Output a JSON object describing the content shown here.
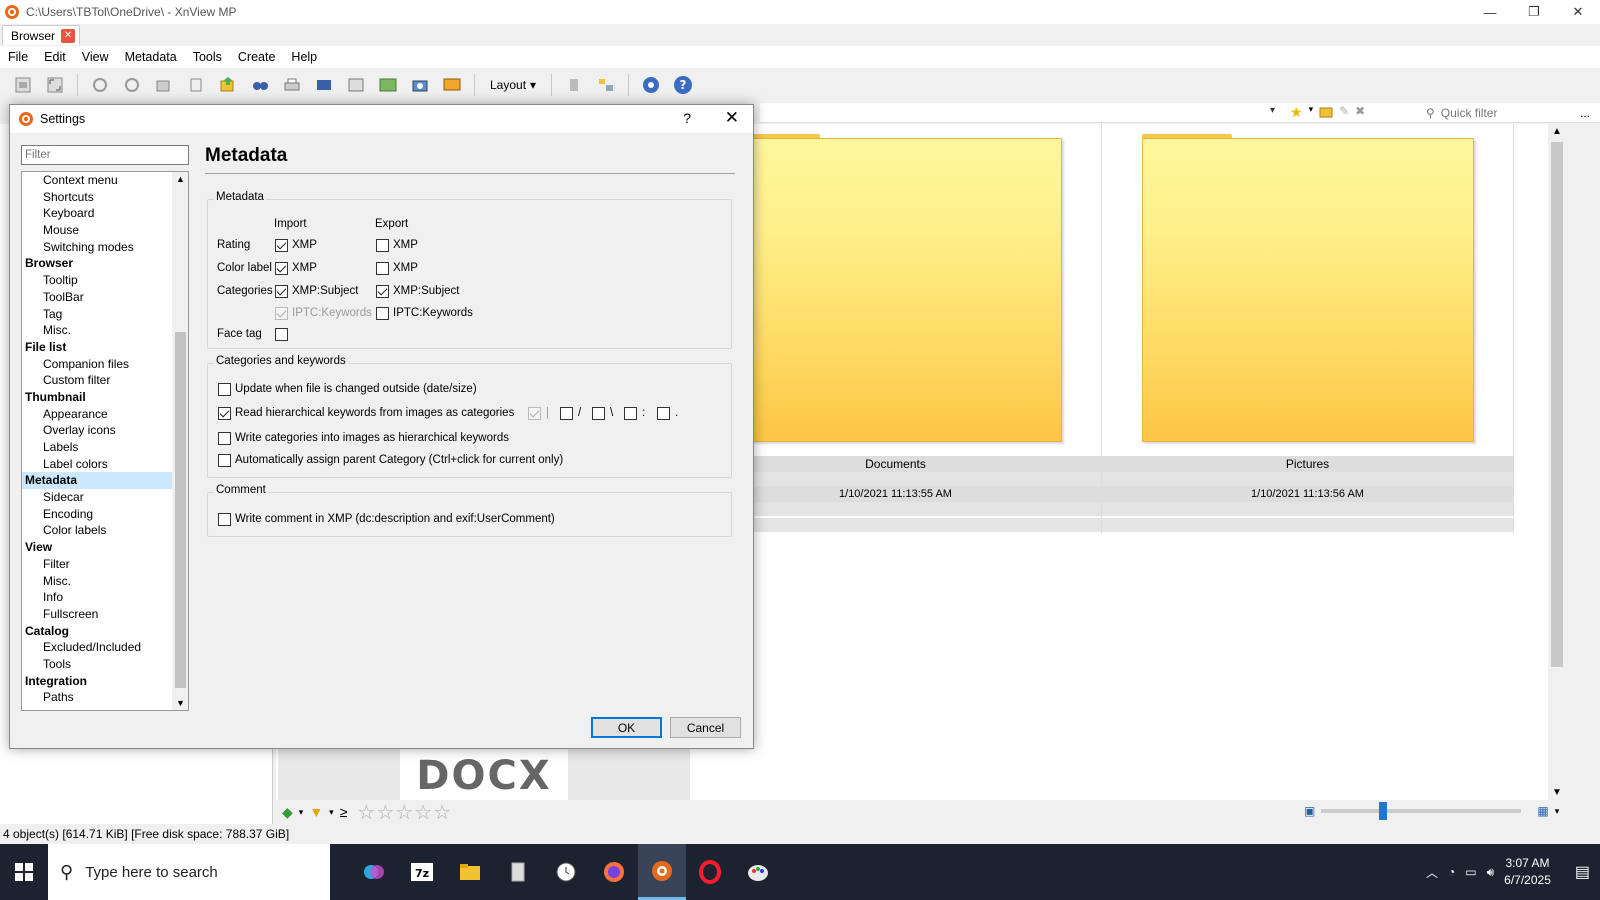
{
  "window": {
    "title": "C:\\Users\\TBTol\\OneDrive\\ - XnView MP",
    "controls": [
      "—",
      "❐",
      "✕"
    ]
  },
  "tab": {
    "label": "Browser",
    "close": "✕"
  },
  "menu": [
    "File",
    "Edit",
    "View",
    "Metadata",
    "Tools",
    "Create",
    "Help"
  ],
  "toolbar": {
    "layout_label": "Layout"
  },
  "quick_filter": {
    "placeholder": "Quick filter",
    "more": "..."
  },
  "browser": {
    "items": [
      {
        "name": "Documents",
        "date": "1/10/2021 11:13:55 AM"
      },
      {
        "name": "Pictures",
        "date": "1/10/2021 11:13:56 AM"
      }
    ],
    "docx_label": "DOCX"
  },
  "bottom": {
    "ge_symbol": "≥"
  },
  "status": {
    "text": "4 object(s) [614.71 KiB] [Free disk space: 788.37 GiB]"
  },
  "taskbar": {
    "search_placeholder": "Type here to search",
    "time": "3:07 AM",
    "date": "6/7/2025"
  },
  "dialog": {
    "title": "Settings",
    "help": "?",
    "close": "✕",
    "filter_placeholder": "Filter",
    "page_title": "Metadata",
    "nav": [
      {
        "label": "Context menu",
        "group": false
      },
      {
        "label": "Shortcuts",
        "group": false
      },
      {
        "label": "Keyboard",
        "group": false
      },
      {
        "label": "Mouse",
        "group": false
      },
      {
        "label": "Switching modes",
        "group": false
      },
      {
        "label": "Browser",
        "group": true
      },
      {
        "label": "Tooltip",
        "group": false
      },
      {
        "label": "ToolBar",
        "group": false
      },
      {
        "label": "Tag",
        "group": false
      },
      {
        "label": "Misc.",
        "group": false
      },
      {
        "label": "File list",
        "group": true
      },
      {
        "label": "Companion files",
        "group": false
      },
      {
        "label": "Custom filter",
        "group": false
      },
      {
        "label": "Thumbnail",
        "group": true
      },
      {
        "label": "Appearance",
        "group": false
      },
      {
        "label": "Overlay icons",
        "group": false
      },
      {
        "label": "Labels",
        "group": false
      },
      {
        "label": "Label colors",
        "group": false
      },
      {
        "label": "Metadata",
        "group": true,
        "selected": true
      },
      {
        "label": "Sidecar",
        "group": false
      },
      {
        "label": "Encoding",
        "group": false
      },
      {
        "label": "Color labels",
        "group": false
      },
      {
        "label": "View",
        "group": true
      },
      {
        "label": "Filter",
        "group": false
      },
      {
        "label": "Misc.",
        "group": false
      },
      {
        "label": "Info",
        "group": false
      },
      {
        "label": "Fullscreen",
        "group": false
      },
      {
        "label": "Catalog",
        "group": true
      },
      {
        "label": "Excluded/Included",
        "group": false
      },
      {
        "label": "Tools",
        "group": false
      },
      {
        "label": "Integration",
        "group": true
      },
      {
        "label": "Paths",
        "group": false
      }
    ],
    "metadata_group": {
      "label": "Metadata",
      "import_header": "Import",
      "export_header": "Export",
      "rows": {
        "rating": "Rating",
        "color_label": "Color label",
        "categories": "Categories",
        "face_tag": "Face tag"
      },
      "rating_import": {
        "label": "XMP",
        "checked": true
      },
      "rating_export": {
        "label": "XMP",
        "checked": false
      },
      "color_import": {
        "label": "XMP",
        "checked": true
      },
      "color_export": {
        "label": "XMP",
        "checked": false
      },
      "cat_import": {
        "label": "XMP:Subject",
        "checked": true
      },
      "cat_export": {
        "label": "XMP:Subject",
        "checked": true
      },
      "iptc_import": {
        "label": "IPTC:Keywords",
        "checked": true,
        "disabled": true
      },
      "iptc_export": {
        "label": "IPTC:Keywords",
        "checked": false
      },
      "face_tag": {
        "checked": false
      }
    },
    "keywords_group": {
      "label": "Categories and keywords",
      "update_outside": {
        "label": "Update when file is changed outside (date/size)",
        "checked": false
      },
      "read_hier": {
        "label": "Read hierarchical keywords from images as categories",
        "checked": true
      },
      "separators": [
        "|",
        "/",
        "\\",
        ":",
        "."
      ],
      "write_hier": {
        "label": "Write categories into images as hierarchical keywords",
        "checked": false
      },
      "auto_parent": {
        "label": "Automatically assign parent Category (Ctrl+click for current only)",
        "checked": false
      }
    },
    "comment_group": {
      "label": "Comment",
      "write_comment": {
        "label": "Write comment in XMP (dc:description and exif:UserComment)",
        "checked": false
      }
    },
    "ok": "OK",
    "cancel": "Cancel"
  }
}
